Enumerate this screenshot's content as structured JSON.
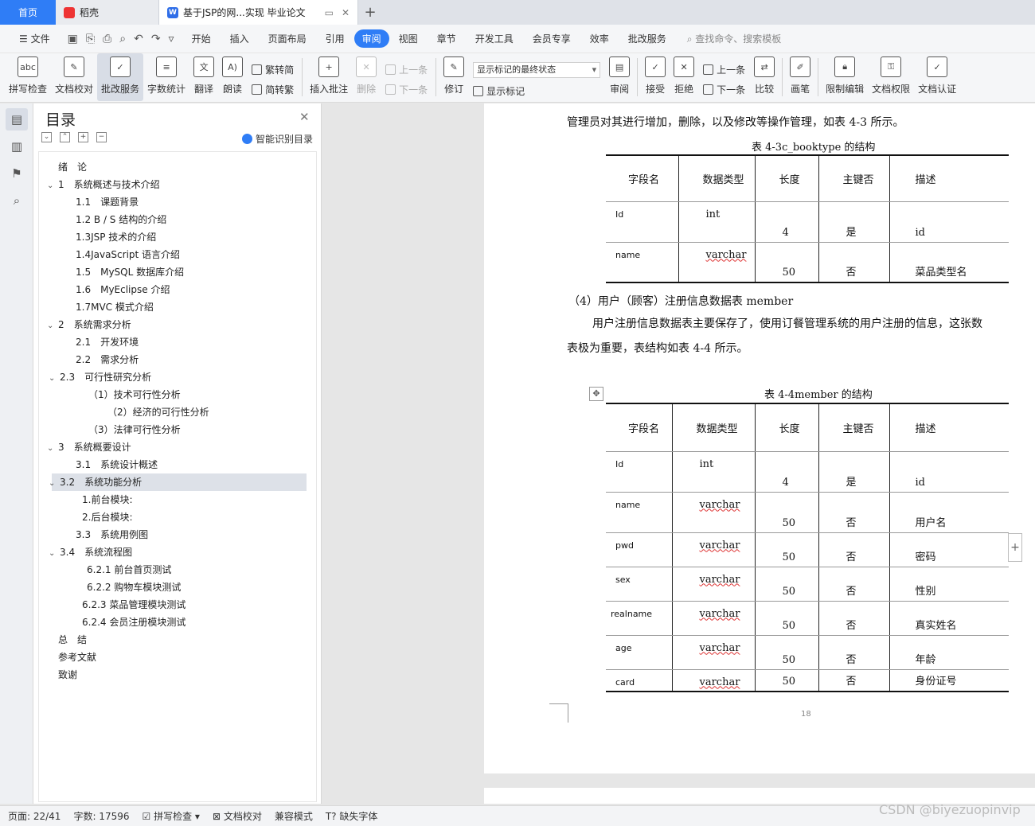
{
  "tabs": {
    "home": "首页",
    "t1": "稻壳",
    "t2": "基于JSP的网...实现 毕业论文"
  },
  "menu": {
    "file": "文件",
    "items": [
      "开始",
      "插入",
      "页面布局",
      "引用",
      "审阅",
      "视图",
      "章节",
      "开发工具",
      "会员专享",
      "效率",
      "批改服务"
    ],
    "search": "查找命令、搜索模板"
  },
  "ribbon": {
    "spell": "拼写检查",
    "proof": "文档校对",
    "grade": "批改服务",
    "wordcount": "字数统计",
    "translate": "翻译",
    "read": "朗读",
    "trad": "繁转简",
    "simp": "简转繁",
    "insert_comment": "插入批注",
    "delete": "删除",
    "prev": "上一条",
    "next": "下一条",
    "revise": "修订",
    "markup_select": "显示标记的最终状态",
    "show_markup": "显示标记",
    "review": "审阅",
    "accept": "接受",
    "reject": "拒绝",
    "prev2": "上一条",
    "next2": "下一条",
    "compare": "比较",
    "draw": "画笔",
    "restrict": "限制编辑",
    "perm": "文档权限",
    "cert": "文档认证"
  },
  "toc": {
    "title": "目录",
    "smart": "智能识别目录",
    "items": [
      {
        "text": "绪　论",
        "indent": 0,
        "caret": ""
      },
      {
        "text": "1　系统概述与技术介绍",
        "indent": 0,
        "caret": "v"
      },
      {
        "text": "1.1　课题背景",
        "indent": 2,
        "caret": ""
      },
      {
        "text": "1.2 B / S 结构的介绍",
        "indent": 2,
        "caret": ""
      },
      {
        "text": "1.3JSP 技术的介绍",
        "indent": 2,
        "caret": ""
      },
      {
        "text": "1.4JavaScript 语言介绍",
        "indent": 2,
        "caret": ""
      },
      {
        "text": "1.5　MySQL 数据库介绍",
        "indent": 2,
        "caret": ""
      },
      {
        "text": "1.6　MyEclipse 介绍",
        "indent": 2,
        "caret": ""
      },
      {
        "text": "1.7MVC 模式介绍",
        "indent": 2,
        "caret": ""
      },
      {
        "text": "2　系统需求分析",
        "indent": 0,
        "caret": "v"
      },
      {
        "text": "2.1　开发环境",
        "indent": 2,
        "caret": ""
      },
      {
        "text": "2.2　需求分析",
        "indent": 2,
        "caret": ""
      },
      {
        "text": "2.3　可行性研究分析",
        "indent": 1,
        "caret": "v"
      },
      {
        "text": "（1）技术可行性分析",
        "indent": 3,
        "caret": ""
      },
      {
        "text": "（2）经济的可行性分析",
        "indent": 4,
        "caret": ""
      },
      {
        "text": "（3）法律可行性分析",
        "indent": 3,
        "caret": ""
      },
      {
        "text": "3　系统概要设计",
        "indent": 0,
        "caret": "v"
      },
      {
        "text": "3.1　系统设计概述",
        "indent": 2,
        "caret": ""
      },
      {
        "text": "3.2　系统功能分析",
        "indent": 1,
        "caret": "v",
        "selected": true
      },
      {
        "text": "1.前台模块:",
        "indent": 5,
        "caret": ""
      },
      {
        "text": "2.后台模块:",
        "indent": 5,
        "caret": ""
      },
      {
        "text": "3.3　系统用例图",
        "indent": 2,
        "caret": ""
      },
      {
        "text": "3.4　系统流程图",
        "indent": 1,
        "caret": "v"
      },
      {
        "text": "6.2.1 前台首页测试",
        "indent": 6,
        "caret": ""
      },
      {
        "text": "6.2.2 购物车模块测试",
        "indent": 6,
        "caret": ""
      },
      {
        "text": "6.2.3 菜品管理模块测试",
        "indent": 5,
        "caret": ""
      },
      {
        "text": "6.2.4 会员注册模块测试",
        "indent": 5,
        "caret": ""
      },
      {
        "text": "总　结",
        "indent": 0,
        "caret": ""
      },
      {
        "text": "参考文献",
        "indent": 0,
        "caret": ""
      },
      {
        "text": "致谢",
        "indent": 0,
        "caret": ""
      }
    ]
  },
  "doc": {
    "p1": "管理员对其进行增加，删除，以及修改等操作管理，如表 4-3 所示。",
    "cap1": "表 4-3c_booktype 的结构",
    "t1_headers": [
      "字段名",
      "数据类型",
      "长度",
      "主键否",
      "描述"
    ],
    "t1_rows": [
      [
        "Id",
        "int",
        "4",
        "是",
        "id"
      ],
      [
        "name",
        "varchar",
        "50",
        "否",
        "菜品类型名"
      ]
    ],
    "p2": "（4）用户（顾客）注册信息数据表 member",
    "p3": "用户注册信息数据表主要保存了，使用订餐管理系统的用户注册的信息，这张数",
    "p4": "表极为重要，表结构如表 4-4 所示。",
    "cap2": "表 4-4member 的结构",
    "t2_headers": [
      "字段名",
      "数据类型",
      "长度",
      "主键否",
      "描述"
    ],
    "t2_rows": [
      [
        "Id",
        "int",
        "4",
        "是",
        "id"
      ],
      [
        "name",
        "varchar",
        "50",
        "否",
        "用户名"
      ],
      [
        "pwd",
        "varchar",
        "50",
        "否",
        "密码"
      ],
      [
        "sex",
        "varchar",
        "50",
        "否",
        "性别"
      ],
      [
        "realname",
        "varchar",
        "50",
        "否",
        "真实姓名"
      ],
      [
        "age",
        "varchar",
        "50",
        "否",
        "年龄"
      ],
      [
        "card",
        "varchar",
        "50",
        "否",
        "身份证号"
      ]
    ],
    "page_number": "18"
  },
  "status": {
    "page": "页面: 22/41",
    "words": "字数: 17596",
    "spell": "拼写检查",
    "proof": "文档校对",
    "compat": "兼容模式",
    "missing_font": "缺失字体"
  },
  "watermark": "CSDN @biyezuopinvip"
}
